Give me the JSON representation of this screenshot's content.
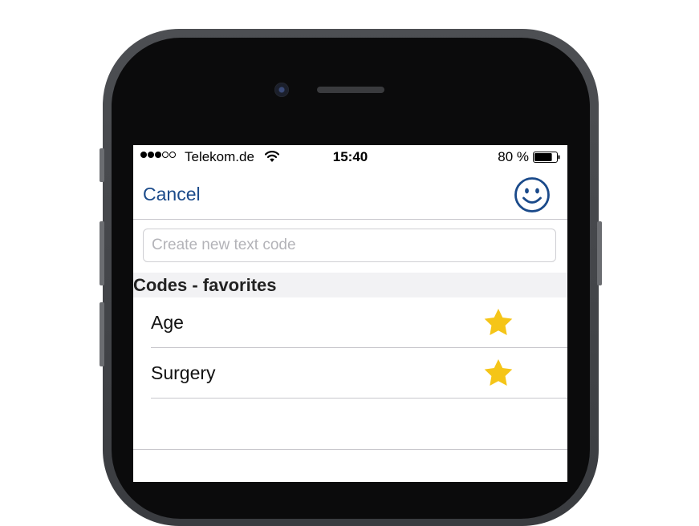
{
  "status_bar": {
    "signal_icon": "signal-dots-icon",
    "carrier": "Telekom.de",
    "wifi_icon": "wifi-icon",
    "time": "15:40",
    "battery_percent": "80 %",
    "battery_icon": "battery-icon",
    "battery_level": 0.8
  },
  "nav": {
    "cancel_label": "Cancel",
    "right_icon": "smiley-icon"
  },
  "search": {
    "value": "",
    "placeholder": "Create new text code"
  },
  "section": {
    "title": "Codes - favorites"
  },
  "items": [
    {
      "label": "Age",
      "favorite": true,
      "icon": "star-icon"
    },
    {
      "label": "Surgery",
      "favorite": true,
      "icon": "star-icon"
    }
  ],
  "colors": {
    "accent": "#1a4a8a",
    "star": "#f5c518",
    "section_bg": "#f2f2f4"
  }
}
